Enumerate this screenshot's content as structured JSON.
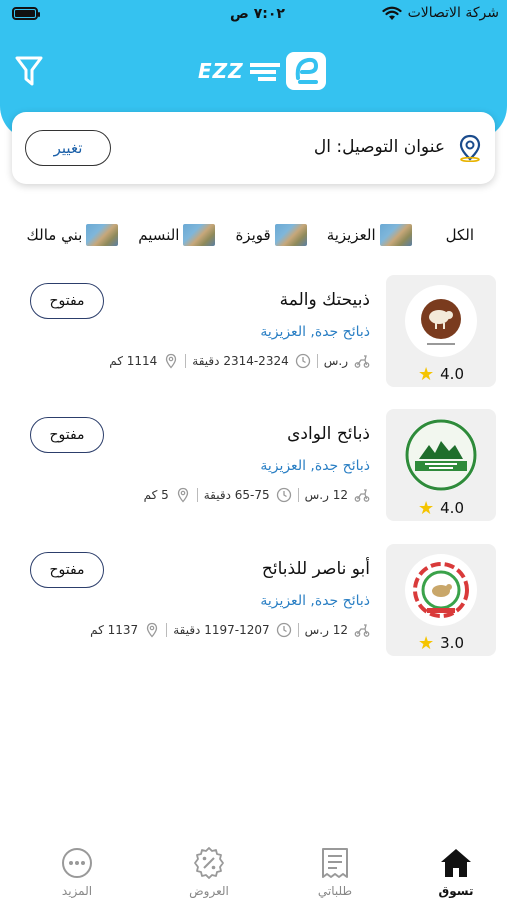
{
  "status": {
    "carrier": "شركة الاتصالات",
    "time": "٧:٠٢ ص"
  },
  "header": {
    "logo_text": "EZZ"
  },
  "address": {
    "label": "عنوان التوصيل: ال",
    "change_label": "تغيير"
  },
  "categories": [
    {
      "label": "الكل"
    },
    {
      "label": "العزيزية"
    },
    {
      "label": "قويزة"
    },
    {
      "label": "النسيم"
    },
    {
      "label": "بني مالك"
    }
  ],
  "stores": [
    {
      "name": "ذبيحتك والمة",
      "category": "ذبائح جدة, العزيزية",
      "delivery_fee": "ر.س",
      "time": "2314-2324 دقيقة",
      "distance": "1114 كم",
      "rating": "4.0",
      "status": "مفتوح"
    },
    {
      "name": "ذبائح الوادى",
      "category": "ذبائح جدة, العزيزية",
      "delivery_fee": "12 ر.س",
      "time": "65-75 دقيقة",
      "distance": "5 كم",
      "rating": "4.0",
      "status": "مفتوح"
    },
    {
      "name": "أبو ناصر للذبائح",
      "category": "ذبائح جدة, العزيزية",
      "delivery_fee": "12 ر.س",
      "time": "1197-1207 دقيقة",
      "distance": "1137 كم",
      "rating": "3.0",
      "status": "مفتوح"
    }
  ],
  "nav": [
    {
      "label": "تسوق",
      "icon": "home-icon",
      "active": true
    },
    {
      "label": "طلباتي",
      "icon": "orders-icon",
      "active": false
    },
    {
      "label": "العروض",
      "icon": "discount-icon",
      "active": false
    },
    {
      "label": "المزيد",
      "icon": "more-icon",
      "active": false
    }
  ],
  "colors": {
    "header": "#35c2f0",
    "link": "#2a7fc4",
    "star": "#f5c400"
  }
}
